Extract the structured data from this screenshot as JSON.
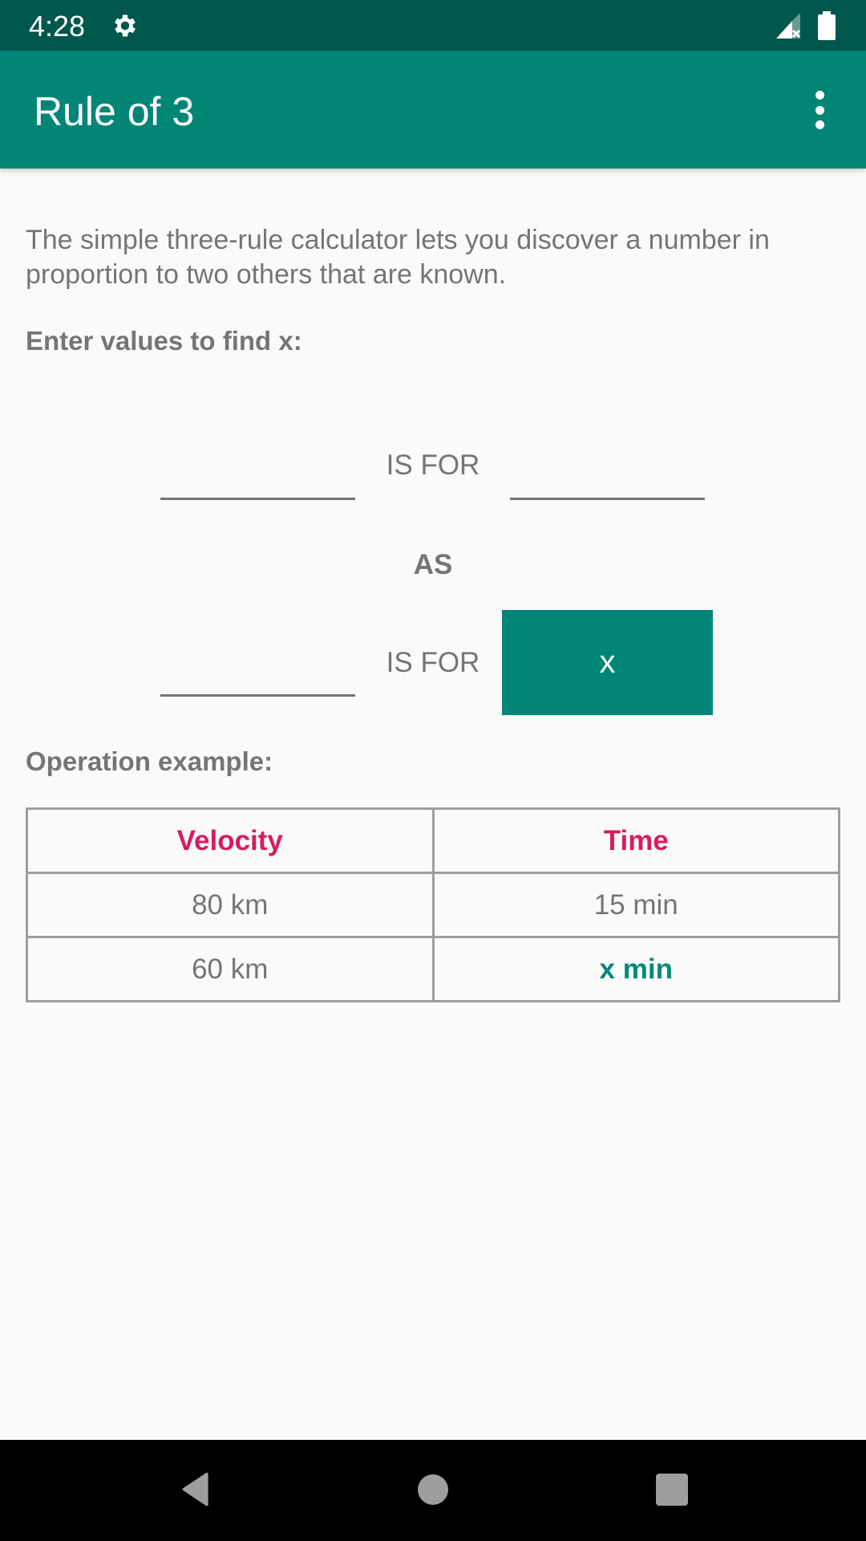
{
  "status_bar": {
    "time": "4:28",
    "icons": [
      "gear-icon",
      "signal-no-service-icon",
      "battery-icon"
    ]
  },
  "app_bar": {
    "title": "Rule of 3",
    "overflow_icon": "more-vert-icon"
  },
  "intro_text": "The simple three-rule calculator lets you discover a number in proportion to two others that are known.",
  "find_heading": "Enter values to find x:",
  "calculator": {
    "field_a": {
      "value": "",
      "placeholder": ""
    },
    "field_b": {
      "value": "",
      "placeholder": ""
    },
    "field_c": {
      "value": "",
      "placeholder": ""
    },
    "is_for_label": "IS FOR",
    "as_label": "AS",
    "result_button_label": "x"
  },
  "example_heading": "Operation example:",
  "example_table": {
    "headers": [
      "Velocity",
      "Time"
    ],
    "rows": [
      [
        "80 km",
        "15 min"
      ],
      [
        "60 km",
        "x min"
      ]
    ]
  },
  "colors": {
    "primary": "#008577",
    "primary_dark": "#00574b",
    "accent": "#d81b60",
    "answer": "#00897b"
  },
  "nav_bar": {
    "buttons": [
      "back-icon",
      "home-icon",
      "recents-icon"
    ]
  }
}
